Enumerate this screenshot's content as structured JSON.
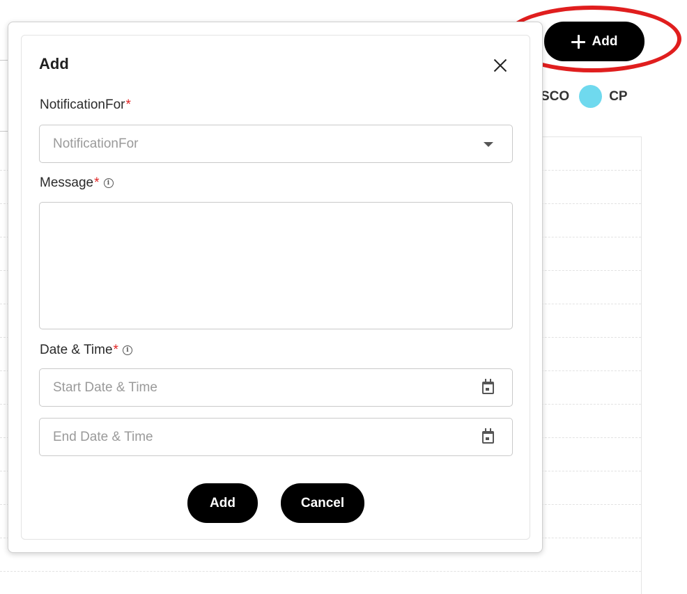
{
  "header": {
    "add_button_label": "Add",
    "add_button_icon": "plus-icon"
  },
  "legend": {
    "items": [
      {
        "label": "SCO"
      },
      {
        "label": "CP",
        "color": "#6fd9ee"
      }
    ]
  },
  "annotation": {
    "color": "#e01e1e"
  },
  "modal": {
    "title": "Add",
    "close_icon": "close-icon",
    "fields": {
      "notification_for": {
        "label": "NotificationFor",
        "required_mark": "*",
        "placeholder": "NotificationFor",
        "icon": "caret-down-icon"
      },
      "message": {
        "label": "Message",
        "required_mark": "*",
        "info_icon": "info-icon",
        "value": ""
      },
      "date_time": {
        "label": "Date & Time",
        "required_mark": "*",
        "info_icon": "info-icon",
        "start_placeholder": "Start Date & Time",
        "end_placeholder": "End Date & Time",
        "icon": "calendar-icon"
      }
    },
    "buttons": {
      "submit_label": "Add",
      "cancel_label": "Cancel"
    }
  },
  "colors": {
    "primary_button": "#000000",
    "required": "#e02424",
    "legend_cp": "#6fd9ee"
  }
}
